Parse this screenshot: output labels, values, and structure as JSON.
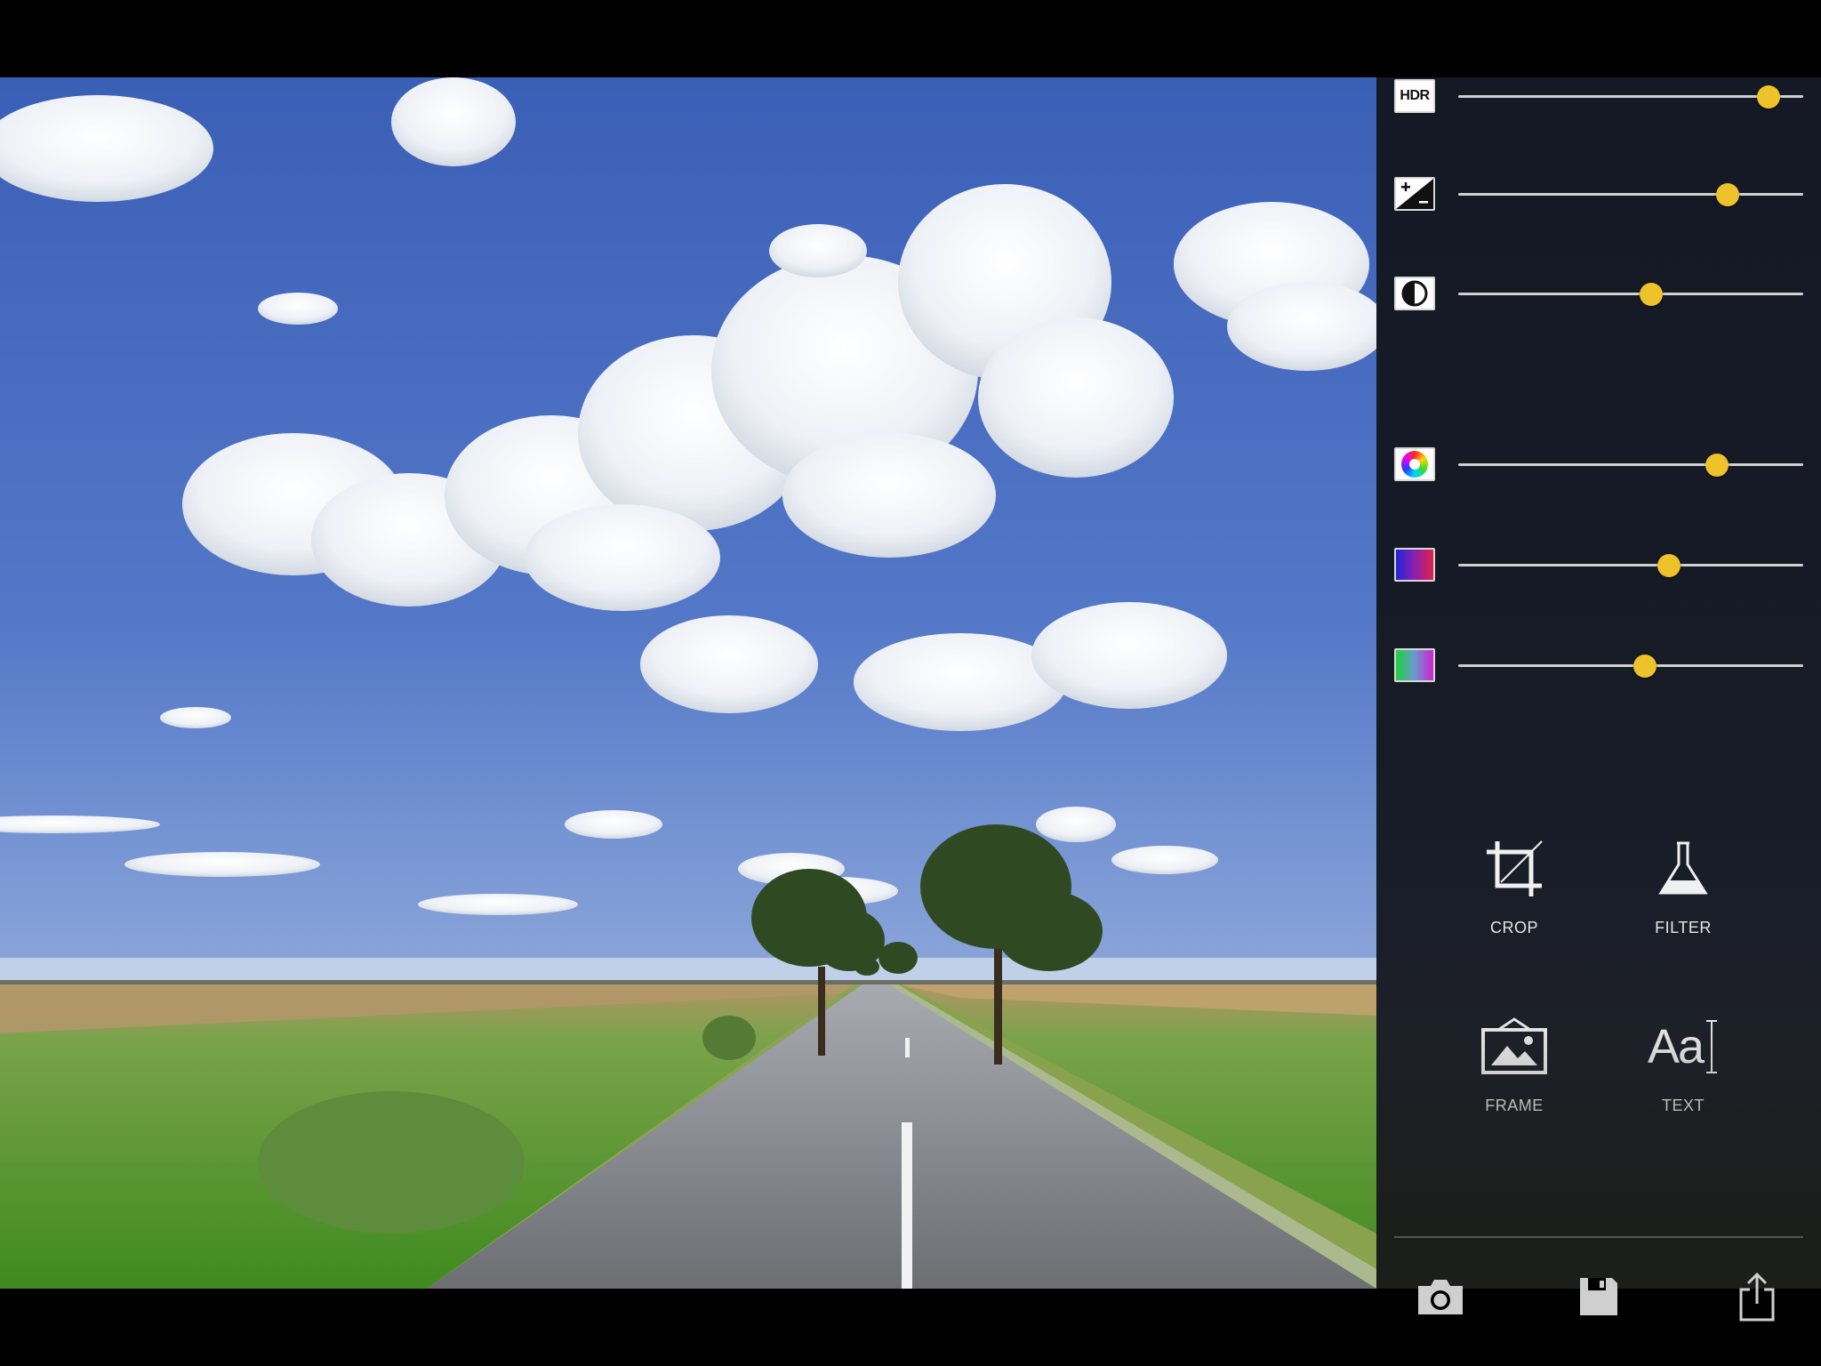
{
  "photo": {
    "description_icon": "landscape-photo"
  },
  "adjustments": {
    "accent_color": "#eec22a",
    "sliders": [
      {
        "name": "hdr",
        "icon": "hdr-icon",
        "icon_text": "HDR",
        "value": 0.9
      },
      {
        "name": "exposure",
        "icon": "exposure-icon",
        "value": 0.78
      },
      {
        "name": "contrast",
        "icon": "contrast-icon",
        "value": 0.56
      },
      {
        "name": "saturation",
        "icon": "color-wheel-icon",
        "value": 0.75
      },
      {
        "name": "temperature",
        "icon": "blue-red-gradient-icon",
        "value": 0.61
      },
      {
        "name": "tint",
        "icon": "green-magenta-gradient-icon",
        "value": 0.54
      }
    ]
  },
  "tools": {
    "crop": {
      "label": "CROP",
      "icon": "crop-icon"
    },
    "filter": {
      "label": "FILTER",
      "icon": "flask-icon"
    },
    "frame": {
      "label": "FRAME",
      "icon": "frame-icon"
    },
    "text": {
      "label": "TEXT",
      "icon": "text-icon",
      "icon_text": "Aa"
    }
  },
  "bottom_bar": [
    {
      "name": "camera",
      "icon": "camera-icon"
    },
    {
      "name": "save",
      "icon": "save-icon"
    },
    {
      "name": "share",
      "icon": "share-icon"
    }
  ]
}
